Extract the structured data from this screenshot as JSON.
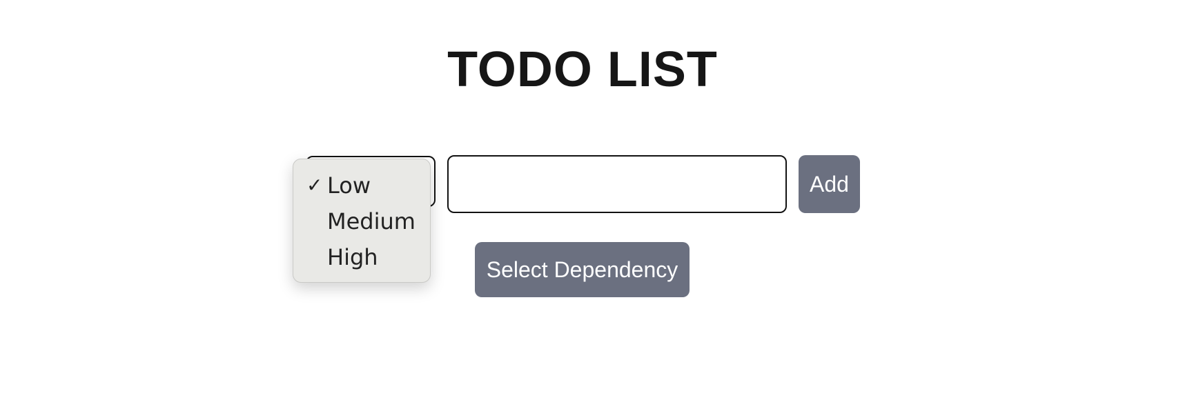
{
  "header": {
    "title": "TODO LIST"
  },
  "form": {
    "priority": {
      "selected": "Low",
      "options": [
        "Low",
        "Medium",
        "High"
      ]
    },
    "task_input": {
      "value": "",
      "placeholder": ""
    },
    "add_label": "Add",
    "dependency_label": "Select Dependency"
  },
  "icons": {
    "check": "check-icon"
  },
  "colors": {
    "button_bg": "#6b7080",
    "button_text": "#ffffff",
    "dropdown_bg": "#e9e9e6"
  }
}
